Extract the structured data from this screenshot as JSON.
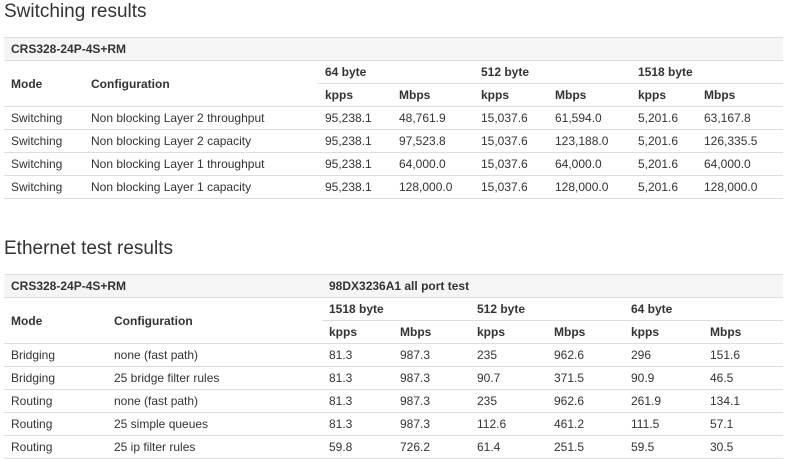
{
  "switching": {
    "title": "Switching results",
    "model": "CRS328-24P-4S+RM",
    "mode_header": "Mode",
    "config_header": "Configuration",
    "groups": [
      "64 byte",
      "512 byte",
      "1518 byte"
    ],
    "subheaders": [
      "kpps",
      "Mbps",
      "kpps",
      "Mbps",
      "kpps",
      "Mbps"
    ],
    "rows": [
      [
        "Switching",
        "Non blocking Layer 2 throughput",
        "95,238.1",
        "48,761.9",
        "15,037.6",
        "61,594.0",
        "5,201.6",
        "63,167.8"
      ],
      [
        "Switching",
        "Non blocking Layer 2 capacity",
        "95,238.1",
        "97,523.8",
        "15,037.6",
        "123,188.0",
        "5,201.6",
        "126,335.5"
      ],
      [
        "Switching",
        "Non blocking Layer 1 throughput",
        "95,238.1",
        "64,000.0",
        "15,037.6",
        "64,000.0",
        "5,201.6",
        "64,000.0"
      ],
      [
        "Switching",
        "Non blocking Layer 1 capacity",
        "95,238.1",
        "128,000.0",
        "15,037.6",
        "128,000.0",
        "5,201.6",
        "128,000.0"
      ]
    ]
  },
  "ethernet": {
    "title": "Ethernet test results",
    "model": "CRS328-24P-4S+RM",
    "test_name": "98DX3236A1 all port test",
    "mode_header": "Mode",
    "config_header": "Configuration",
    "groups": [
      "1518 byte",
      "512 byte",
      "64 byte"
    ],
    "subheaders": [
      "kpps",
      "Mbps",
      "kpps",
      "Mbps",
      "kpps",
      "Mbps"
    ],
    "rows": [
      [
        "Bridging",
        "none (fast path)",
        "81.3",
        "987.3",
        "235",
        "962.6",
        "296",
        "151.6"
      ],
      [
        "Bridging",
        "25 bridge filter rules",
        "81.3",
        "987.3",
        "90.7",
        "371.5",
        "90.9",
        "46.5"
      ],
      [
        "Routing",
        "none (fast path)",
        "81.3",
        "987.3",
        "235",
        "962.6",
        "261.9",
        "134.1"
      ],
      [
        "Routing",
        "25 simple queues",
        "81.3",
        "987.3",
        "112.6",
        "461.2",
        "111.5",
        "57.1"
      ],
      [
        "Routing",
        "25 ip filter rules",
        "59.8",
        "726.2",
        "61.4",
        "251.5",
        "59.5",
        "30.5"
      ]
    ]
  }
}
